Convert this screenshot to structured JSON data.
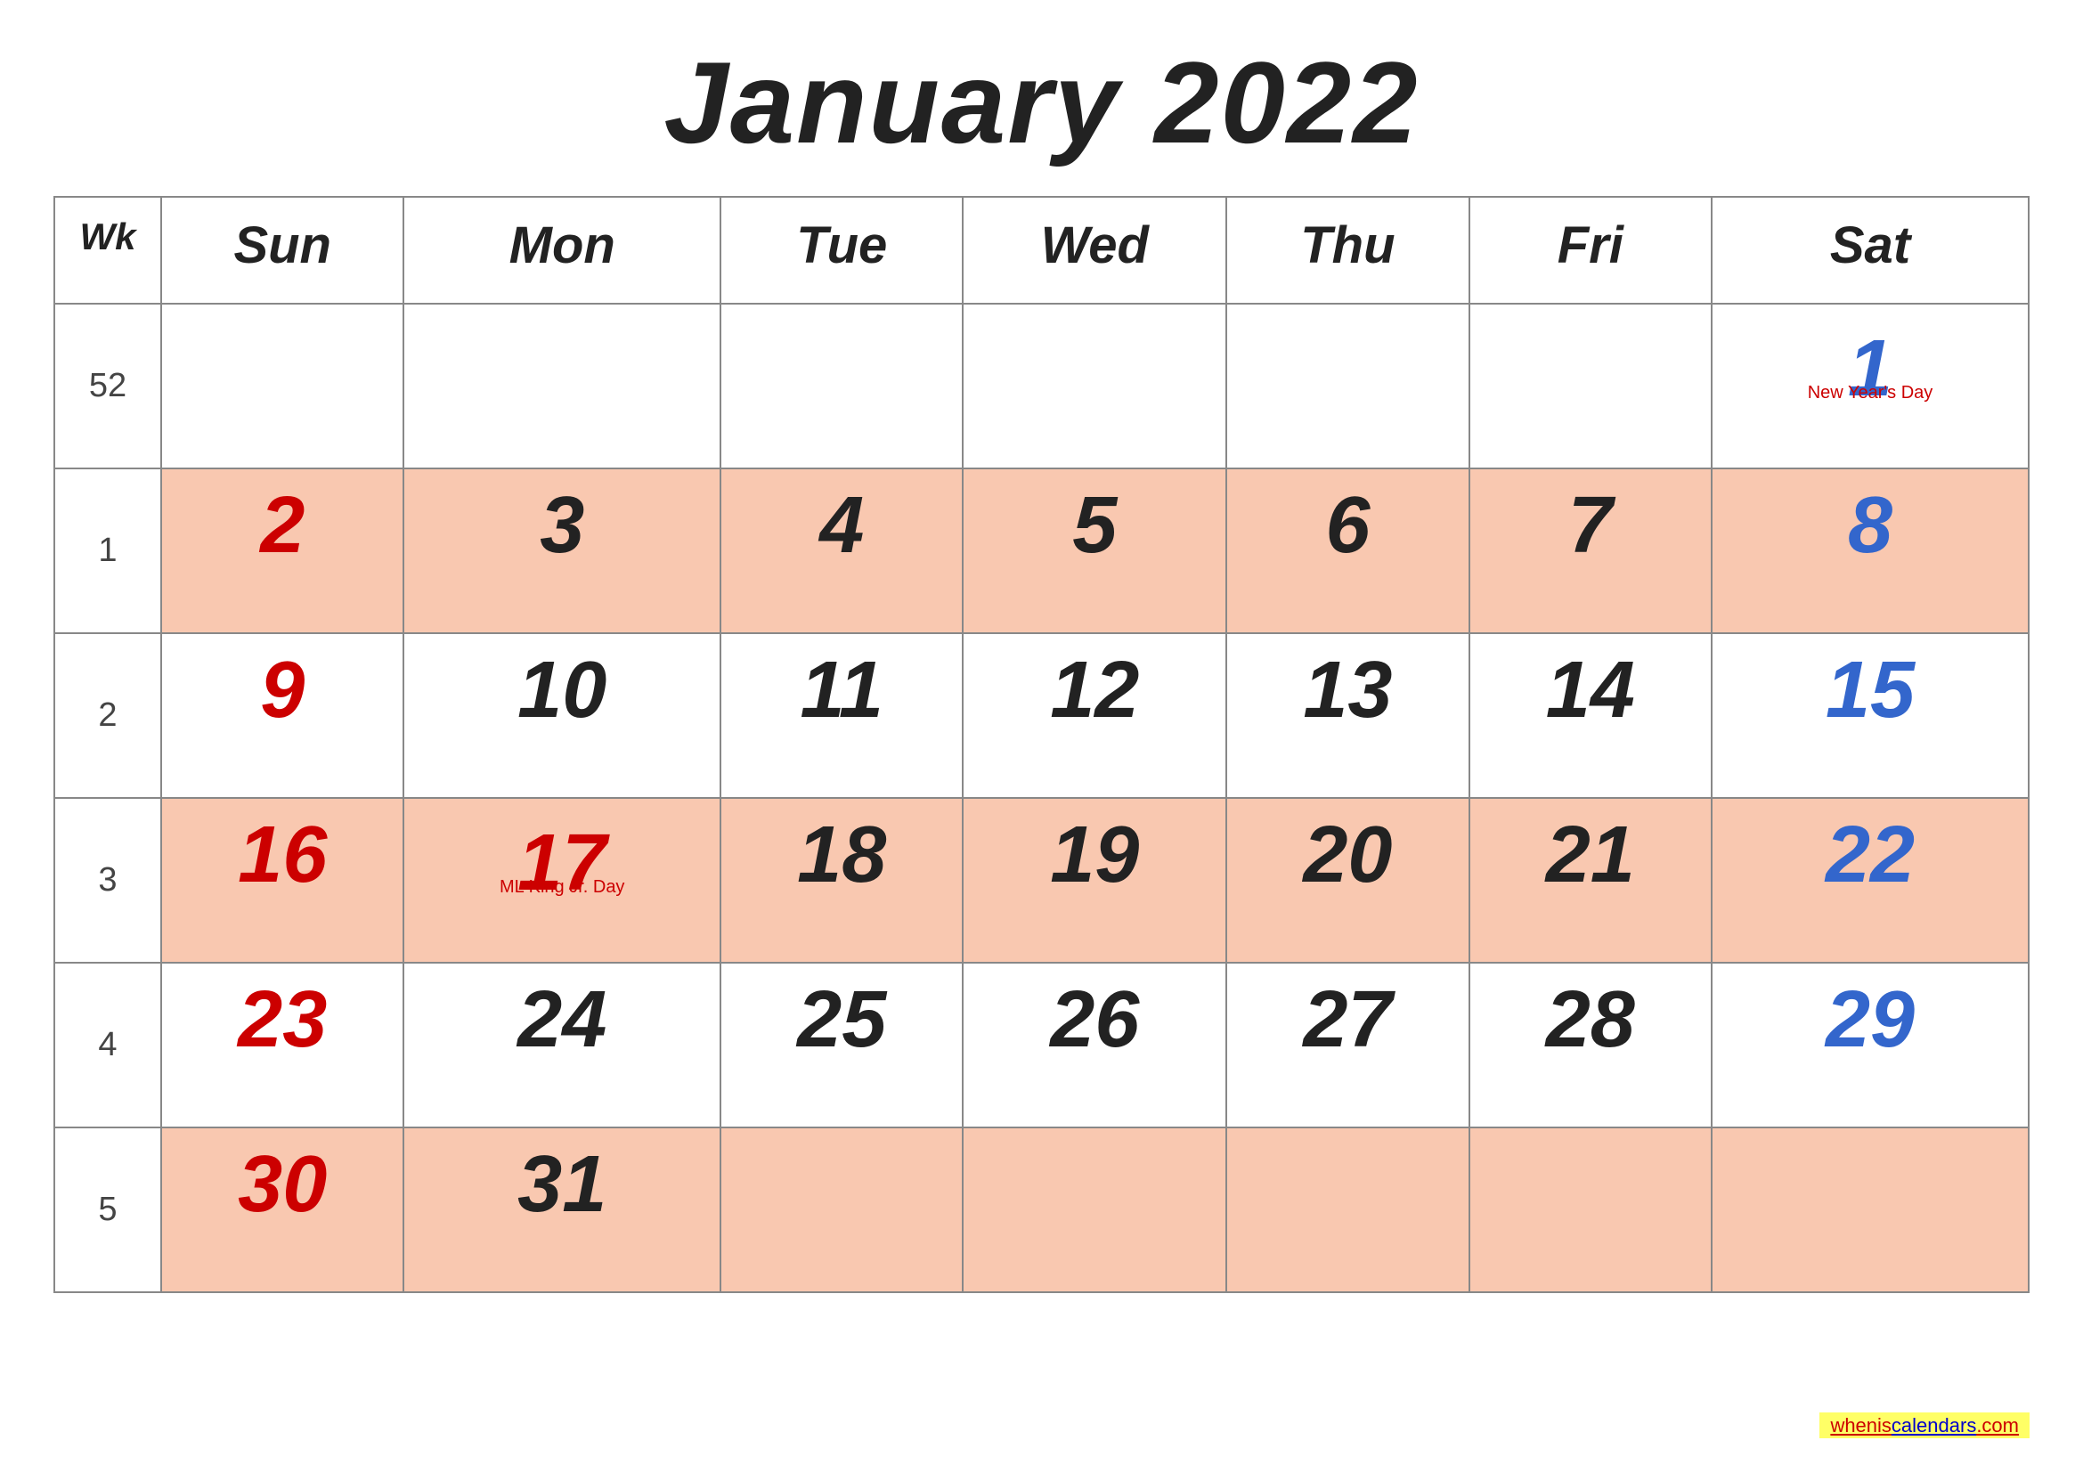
{
  "title": "January 2022",
  "headers": {
    "wk": "Wk",
    "sun": "Sun",
    "mon": "Mon",
    "tue": "Tue",
    "wed": "Wed",
    "thu": "Thu",
    "fri": "Fri",
    "sat": "Sat"
  },
  "weeks": [
    {
      "wk": "52",
      "highlight": false,
      "days": [
        {
          "num": "",
          "type": "sun"
        },
        {
          "num": "",
          "type": "mon"
        },
        {
          "num": "",
          "type": "tue"
        },
        {
          "num": "",
          "type": "wed"
        },
        {
          "num": "",
          "type": "thu"
        },
        {
          "num": "",
          "type": "fri"
        },
        {
          "num": "1",
          "type": "sat",
          "holiday": "New Year's Day"
        }
      ]
    },
    {
      "wk": "1",
      "highlight": true,
      "days": [
        {
          "num": "2",
          "type": "sun"
        },
        {
          "num": "3",
          "type": "mon"
        },
        {
          "num": "4",
          "type": "tue"
        },
        {
          "num": "5",
          "type": "wed"
        },
        {
          "num": "6",
          "type": "thu"
        },
        {
          "num": "7",
          "type": "fri"
        },
        {
          "num": "8",
          "type": "sat"
        }
      ]
    },
    {
      "wk": "2",
      "highlight": false,
      "days": [
        {
          "num": "9",
          "type": "sun"
        },
        {
          "num": "10",
          "type": "mon"
        },
        {
          "num": "11",
          "type": "tue"
        },
        {
          "num": "12",
          "type": "wed"
        },
        {
          "num": "13",
          "type": "thu"
        },
        {
          "num": "14",
          "type": "fri"
        },
        {
          "num": "15",
          "type": "sat"
        }
      ]
    },
    {
      "wk": "3",
      "highlight": true,
      "days": [
        {
          "num": "16",
          "type": "sun"
        },
        {
          "num": "17",
          "type": "mon",
          "holiday": "ML King Jr. Day"
        },
        {
          "num": "18",
          "type": "tue"
        },
        {
          "num": "19",
          "type": "wed"
        },
        {
          "num": "20",
          "type": "thu"
        },
        {
          "num": "21",
          "type": "fri"
        },
        {
          "num": "22",
          "type": "sat"
        }
      ]
    },
    {
      "wk": "4",
      "highlight": false,
      "days": [
        {
          "num": "23",
          "type": "sun"
        },
        {
          "num": "24",
          "type": "mon"
        },
        {
          "num": "25",
          "type": "tue"
        },
        {
          "num": "26",
          "type": "wed"
        },
        {
          "num": "27",
          "type": "thu"
        },
        {
          "num": "28",
          "type": "fri"
        },
        {
          "num": "29",
          "type": "sat"
        }
      ]
    },
    {
      "wk": "5",
      "highlight": true,
      "days": [
        {
          "num": "30",
          "type": "sun"
        },
        {
          "num": "31",
          "type": "mon"
        },
        {
          "num": "",
          "type": "tue"
        },
        {
          "num": "",
          "type": "wed"
        },
        {
          "num": "",
          "type": "thu"
        },
        {
          "num": "",
          "type": "fri"
        },
        {
          "num": "",
          "type": "sat"
        }
      ]
    }
  ],
  "watermark": {
    "text1": "whenis",
    "text2": "calendars",
    "text3": ".com"
  }
}
